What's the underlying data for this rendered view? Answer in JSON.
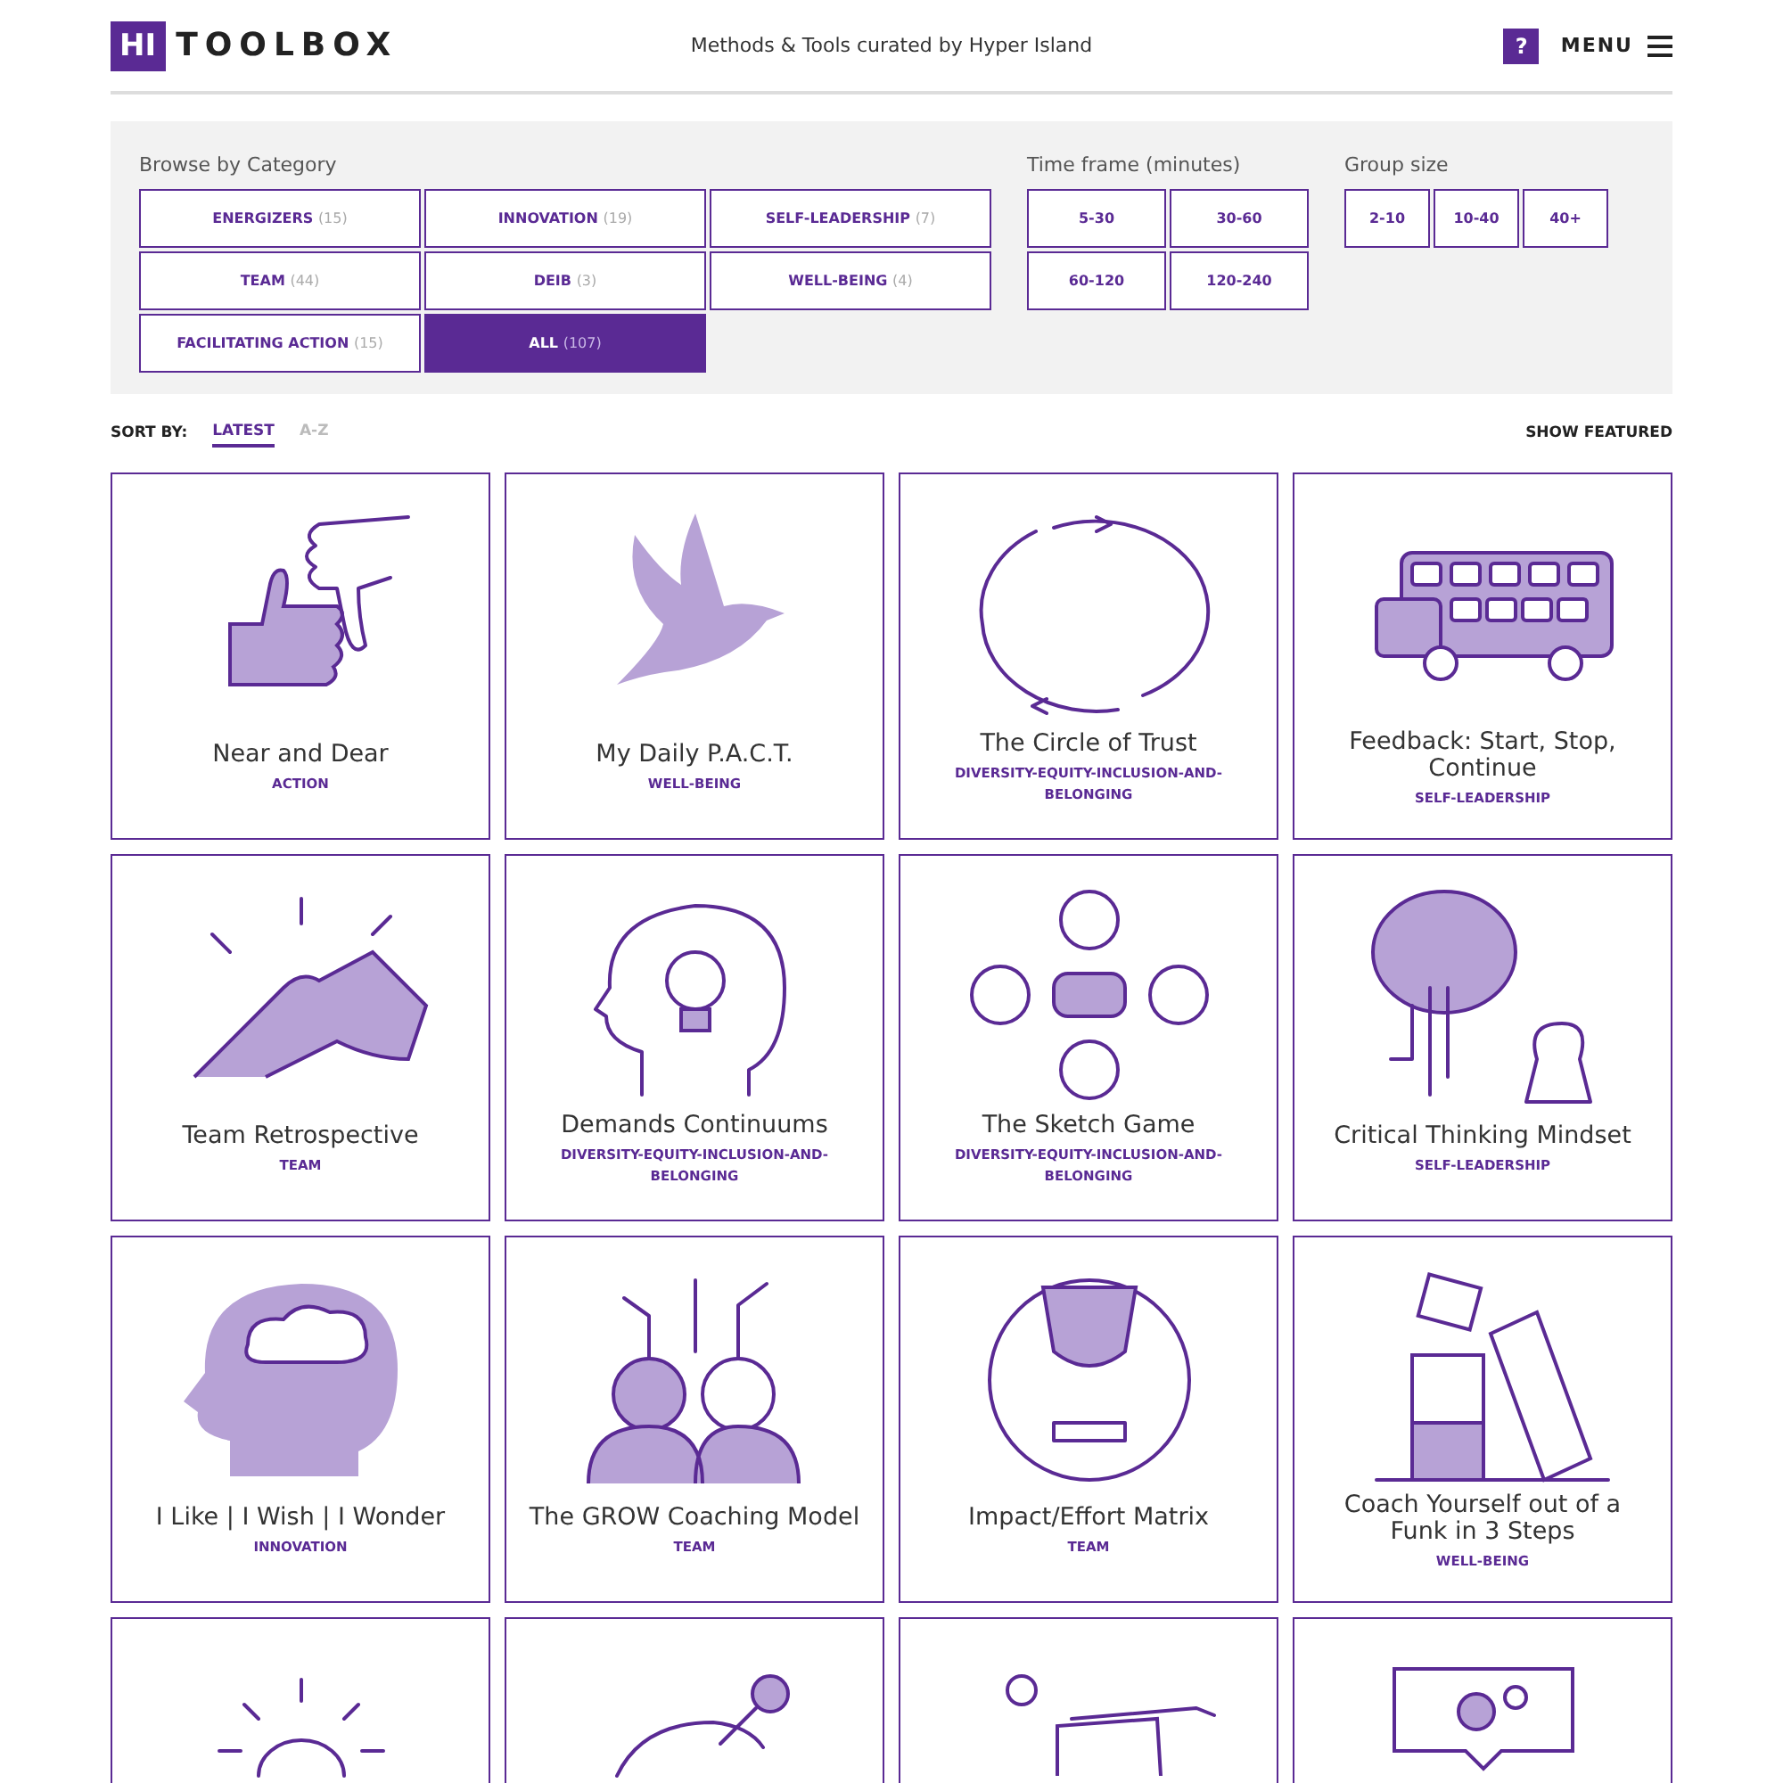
{
  "header": {
    "logo_mark": "HI",
    "logo_text": "TOOLBOX",
    "tagline": "Methods & Tools curated by Hyper Island",
    "help": "?",
    "menu": "MENU"
  },
  "filters": {
    "category": {
      "label": "Browse by Category",
      "options": [
        {
          "label": "ENERGIZERS",
          "count": "(15)",
          "selected": false
        },
        {
          "label": "INNOVATION",
          "count": "(19)",
          "selected": false
        },
        {
          "label": "SELF-LEADERSHIP",
          "count": "(7)",
          "selected": false
        },
        {
          "label": "TEAM",
          "count": "(44)",
          "selected": false
        },
        {
          "label": "DEIB",
          "count": "(3)",
          "selected": false
        },
        {
          "label": "WELL-BEING",
          "count": "(4)",
          "selected": false
        },
        {
          "label": "FACILITATING ACTION",
          "count": "(15)",
          "selected": false
        },
        {
          "label": "ALL",
          "count": "(107)",
          "selected": true
        }
      ]
    },
    "time_frame": {
      "label": "Time frame (minutes)",
      "options": [
        {
          "label": "5-30",
          "selected": false
        },
        {
          "label": "30-60",
          "selected": false
        },
        {
          "label": "60-120",
          "selected": false
        },
        {
          "label": "120-240",
          "selected": false
        }
      ]
    },
    "group_size": {
      "label": "Group size",
      "options": [
        {
          "label": "2-10",
          "selected": false
        },
        {
          "label": "10-40",
          "selected": false
        },
        {
          "label": "40+",
          "selected": false
        }
      ]
    }
  },
  "sort": {
    "label": "SORT BY:",
    "options": [
      {
        "label": "LATEST",
        "selected": true
      },
      {
        "label": "A-Z",
        "selected": false
      }
    ],
    "show_featured": "SHOW FEATURED"
  },
  "cards": [
    {
      "kind": "thumbs",
      "title": "Near and Dear",
      "tag": "ACTION"
    },
    {
      "kind": "dove",
      "title": "My Daily P.A.C.T.",
      "tag": "WELL-BEING"
    },
    {
      "kind": "circle",
      "title": "The Circle of Trust",
      "tag": "DIVERSITY-EQUITY-INCLUSION-AND-BELONGING"
    },
    {
      "kind": "bus",
      "title": "Feedback: Start, Stop, Continue",
      "tag": "SELF-LEADERSHIP"
    },
    {
      "kind": "hands",
      "title": "Team Retrospective",
      "tag": "TEAM"
    },
    {
      "kind": "bulb",
      "title": "Demands Continuums",
      "tag": "DIVERSITY-EQUITY-INCLUSION-AND-BELONGING"
    },
    {
      "kind": "faces",
      "title": "The Sketch Game",
      "tag": "DIVERSITY-EQUITY-INCLUSION-AND-BELONGING"
    },
    {
      "kind": "tree",
      "title": "Critical Thinking Mindset",
      "tag": "SELF-LEADERSHIP"
    },
    {
      "kind": "cloud",
      "title": "I Like | I Wish | I Wonder",
      "tag": "INNOVATION"
    },
    {
      "kind": "network",
      "title": "The GROW Coaching Model",
      "tag": "TEAM"
    },
    {
      "kind": "trophy",
      "title": "Impact/Effort Matrix",
      "tag": "TEAM"
    },
    {
      "kind": "blocks",
      "title": "Coach Yourself out of a Funk in 3 Steps",
      "tag": "WELL-BEING"
    },
    {
      "kind": "sun"
    },
    {
      "kind": "key"
    },
    {
      "kind": "fist"
    },
    {
      "kind": "gears"
    }
  ]
}
